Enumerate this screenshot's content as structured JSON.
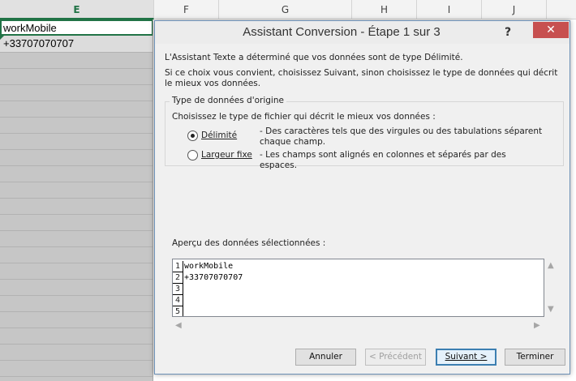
{
  "spreadsheet": {
    "columns": [
      "E",
      "F",
      "G",
      "H",
      "I",
      "J"
    ],
    "selected_column": "E",
    "cells": {
      "e1": "workMobile",
      "e2": "+33707070707"
    }
  },
  "dialog": {
    "title": "Assistant Conversion - Étape 1 sur 3",
    "help_label": "?",
    "close_label": "✕",
    "intro": "L'Assistant Texte a déterminé que vos données sont de type Délimité.",
    "instruction": "Si ce choix vous convient, choisissez Suivant, sinon choisissez le type de données qui décrit le mieux vos données.",
    "group": {
      "legend": "Type de données d'origine",
      "prompt": "Choisissez le type de fichier qui décrit le mieux vos données :",
      "options": [
        {
          "label": "Délimité",
          "description": "- Des caractères tels que des virgules ou des tabulations séparent chaque champ.",
          "checked": true
        },
        {
          "label": "Largeur fixe",
          "description": "- Les champs sont alignés en colonnes et séparés par des espaces.",
          "checked": false
        }
      ]
    },
    "preview": {
      "label": "Aperçu des données sélectionnées :",
      "rows": [
        {
          "num": "1",
          "value": "workMobile"
        },
        {
          "num": "2",
          "value": "+33707070707"
        },
        {
          "num": "3",
          "value": ""
        },
        {
          "num": "4",
          "value": ""
        },
        {
          "num": "5",
          "value": ""
        }
      ]
    },
    "buttons": {
      "cancel": "Annuler",
      "previous": "< Précédent",
      "next": "Suivant >",
      "finish": "Terminer"
    }
  },
  "icons": {
    "scroll_up": "chevron-up-icon",
    "scroll_down": "chevron-down-icon",
    "scroll_left": "chevron-left-icon",
    "scroll_right": "chevron-right-icon"
  },
  "colors": {
    "accent": "#217346",
    "close_button": "#c75050",
    "default_button_border": "#3c7fb1"
  }
}
